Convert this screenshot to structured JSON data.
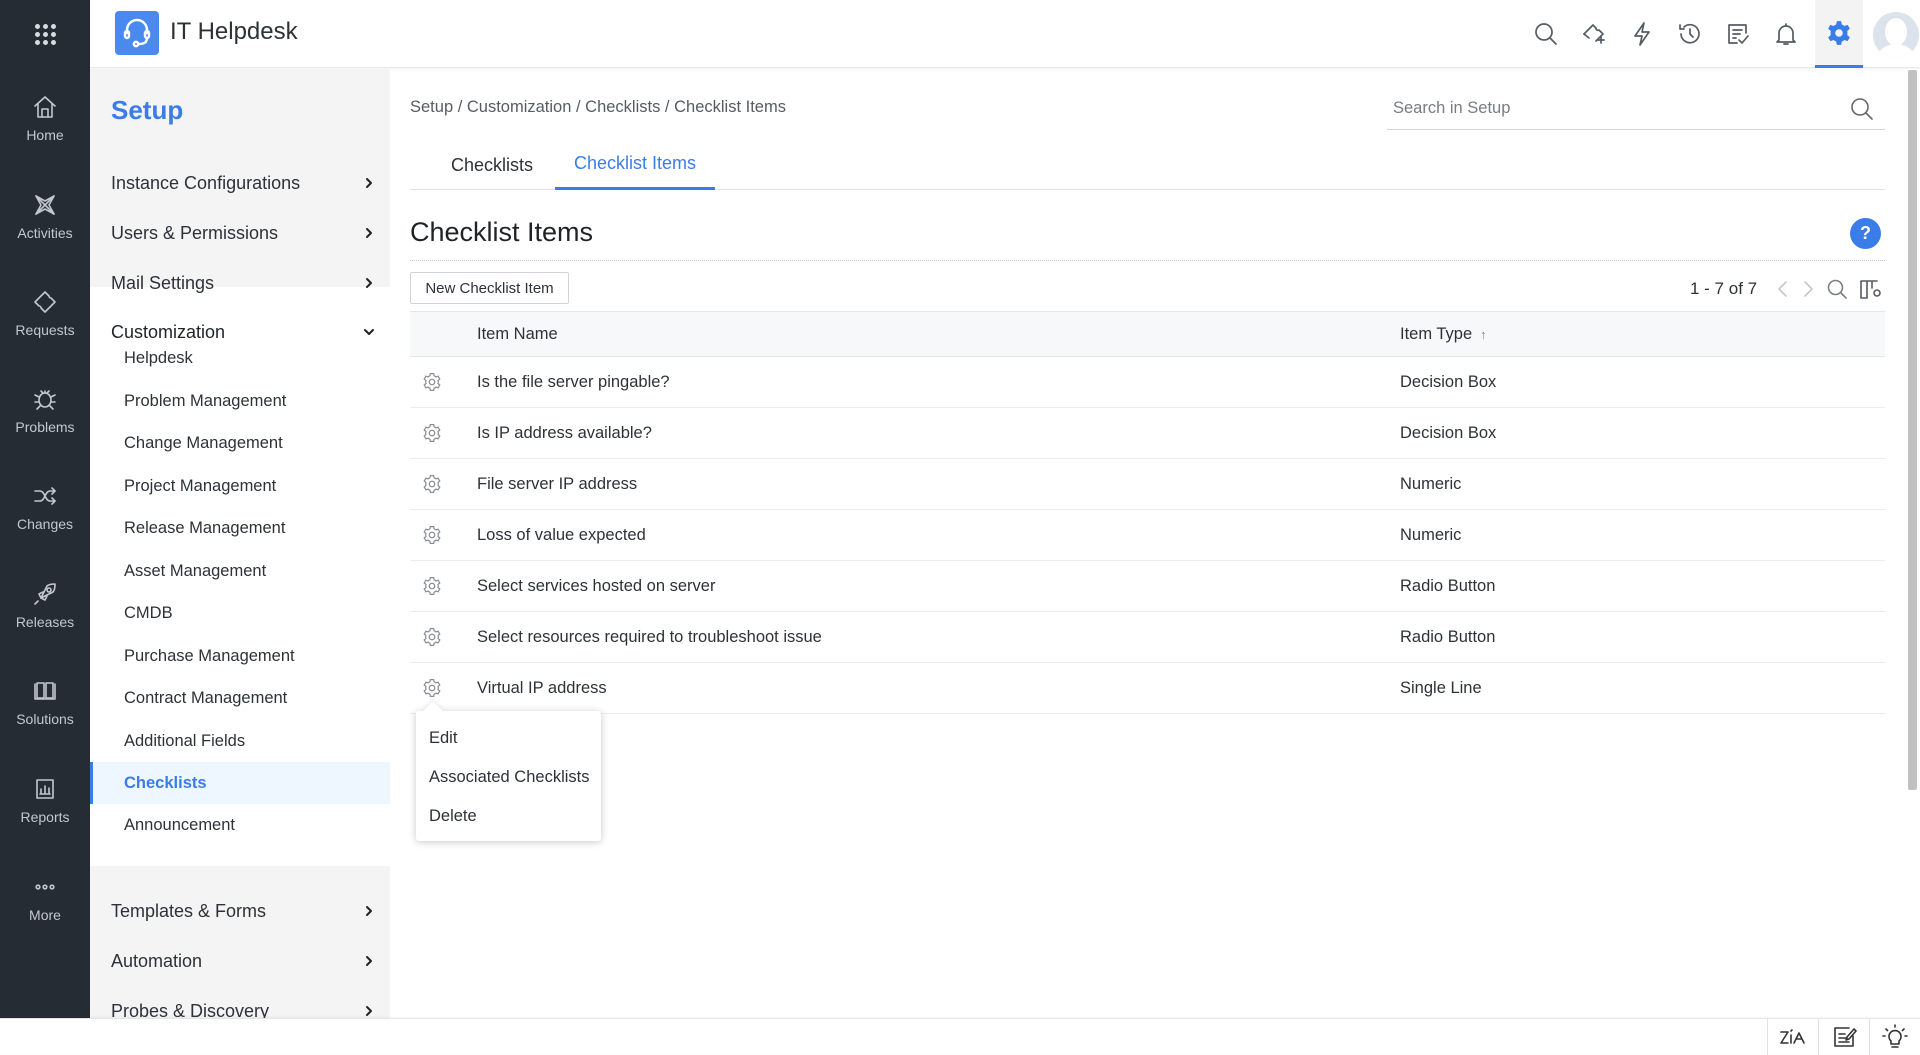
{
  "app": {
    "title": "IT Helpdesk"
  },
  "header_icons": [
    "search-icon",
    "new-ticket-icon",
    "quick-actions-icon",
    "history-icon",
    "tasks-icon",
    "notifications-icon",
    "settings-icon",
    "avatar"
  ],
  "nav": {
    "items": [
      {
        "label": "Home",
        "icon": "home-icon"
      },
      {
        "label": "Activities",
        "icon": "activities-icon"
      },
      {
        "label": "Requests",
        "icon": "requests-icon"
      },
      {
        "label": "Problems",
        "icon": "problems-icon"
      },
      {
        "label": "Changes",
        "icon": "changes-icon"
      },
      {
        "label": "Releases",
        "icon": "releases-icon"
      },
      {
        "label": "Solutions",
        "icon": "solutions-icon"
      },
      {
        "label": "Reports",
        "icon": "reports-icon"
      },
      {
        "label": "More",
        "icon": "more-icon"
      }
    ]
  },
  "setup": {
    "title": "Setup",
    "sections_top": [
      {
        "label": "Instance Configurations"
      },
      {
        "label": "Users & Permissions"
      },
      {
        "label": "Mail Settings"
      }
    ],
    "open_section": {
      "label": "Customization",
      "items": [
        {
          "label": "Helpdesk"
        },
        {
          "label": "Problem Management"
        },
        {
          "label": "Change Management"
        },
        {
          "label": "Project Management"
        },
        {
          "label": "Release Management"
        },
        {
          "label": "Asset Management"
        },
        {
          "label": "CMDB"
        },
        {
          "label": "Purchase Management"
        },
        {
          "label": "Contract Management"
        },
        {
          "label": "Additional Fields"
        },
        {
          "label": "Checklists",
          "active": true
        },
        {
          "label": "Announcement"
        }
      ]
    },
    "sections_bottom": [
      {
        "label": "Templates & Forms"
      },
      {
        "label": "Automation"
      },
      {
        "label": "Probes & Discovery"
      }
    ]
  },
  "main": {
    "breadcrumb": "Setup / Customization / Checklists / Checklist Items",
    "search": {
      "placeholder": "Search in Setup",
      "value": ""
    },
    "tabs": [
      {
        "label": "Checklists",
        "active": false
      },
      {
        "label": "Checklist Items",
        "active": true
      }
    ],
    "page_title": "Checklist Items",
    "help_label": "?",
    "new_button": "New Checklist Item",
    "pager": "1 - 7 of 7",
    "table": {
      "columns": [
        {
          "label": "Item Name"
        },
        {
          "label": "Item Type",
          "sort": "↑"
        }
      ],
      "rows": [
        {
          "name": "Is the file server pingable?",
          "type": "Decision Box"
        },
        {
          "name": "Is IP address available?",
          "type": "Decision Box"
        },
        {
          "name": "File server IP address",
          "type": "Numeric"
        },
        {
          "name": "Loss of value expected",
          "type": "Numeric"
        },
        {
          "name": "Select services hosted on server",
          "type": "Radio Button"
        },
        {
          "name": "Select resources required to troubleshoot issue",
          "type": "Radio Button"
        },
        {
          "name": "Virtual IP address",
          "type": "Single Line"
        }
      ]
    },
    "context_menu": {
      "items": [
        {
          "label": "Edit"
        },
        {
          "label": "Associated Checklists"
        },
        {
          "label": "Delete"
        }
      ]
    }
  },
  "statusbar": {
    "icons": [
      "zia-icon",
      "notes-icon",
      "tips-icon"
    ]
  },
  "colors": {
    "accent": "#3a7de8",
    "nav_bg": "#262c33",
    "panel_gray": "#f4f4f4",
    "active_item_bg": "#eef6ff"
  }
}
